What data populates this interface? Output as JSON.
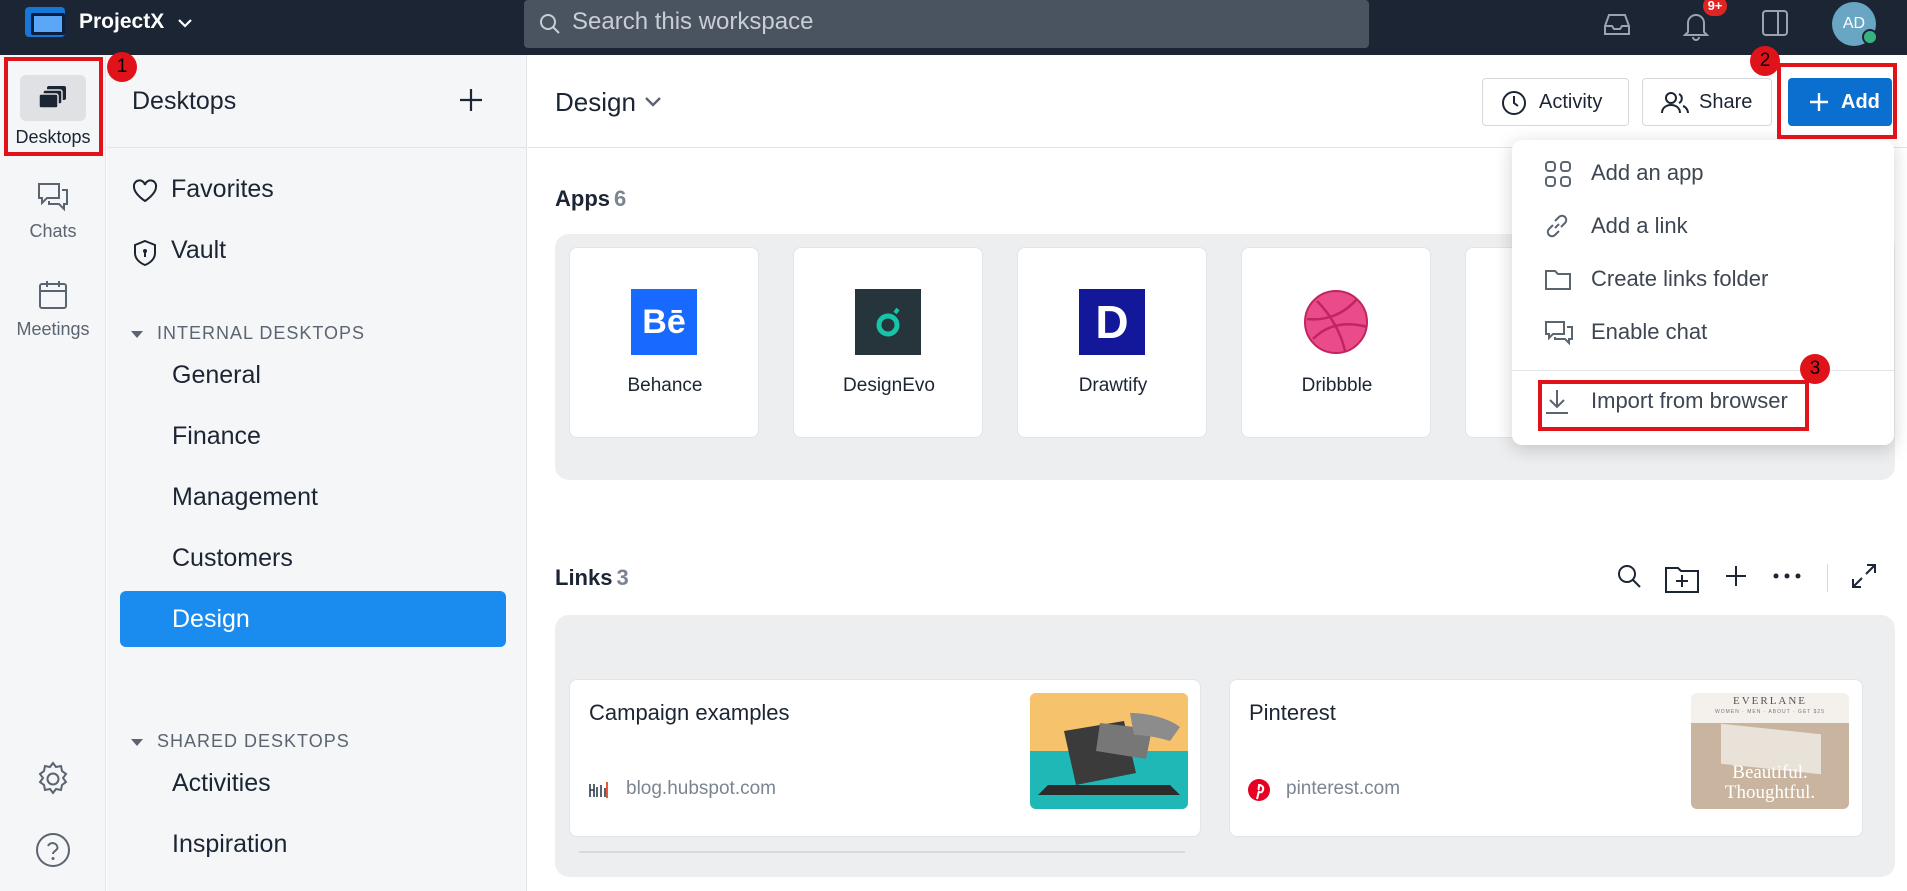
{
  "topbar": {
    "app_name": "ProjectX",
    "search_placeholder": "Search this workspace",
    "notification_badge": "9+",
    "avatar_initials": "AD"
  },
  "rail": {
    "items": [
      {
        "label": "Desktops",
        "icon": "desktops-icon"
      },
      {
        "label": "Chats",
        "icon": "chat-icon"
      },
      {
        "label": "Meetings",
        "icon": "calendar-icon"
      }
    ],
    "bottom_icons": [
      "gear-icon",
      "help-icon"
    ]
  },
  "sidebar": {
    "title": "Desktops",
    "top_items": [
      {
        "label": "Favorites",
        "icon": "heart-icon"
      },
      {
        "label": "Vault",
        "icon": "shield-icon"
      }
    ],
    "internal_section": "INTERNAL DESKTOPS",
    "internal_items": [
      "General",
      "Finance",
      "Management",
      "Customers",
      "Design"
    ],
    "active_item": "Design",
    "shared_section": "SHARED DESKTOPS",
    "shared_items": [
      "Activities",
      "Inspiration"
    ]
  },
  "main": {
    "title": "Design",
    "buttons": {
      "activity": "Activity",
      "share": "Share",
      "add": "Add"
    },
    "apps": {
      "label": "Apps",
      "count": "6",
      "items": [
        {
          "name": "Behance",
          "logo_text": "Bē",
          "color": "#1769ff"
        },
        {
          "name": "DesignEvo",
          "color": "#26343b"
        },
        {
          "name": "Drawtify",
          "logo_text": "D",
          "color": "#13189a"
        },
        {
          "name": "Dribbble",
          "color": "#ea4c89"
        }
      ]
    },
    "links": {
      "label": "Links",
      "count": "3",
      "items": [
        {
          "title": "Campaign examples",
          "domain": "blog.hubspot.com"
        },
        {
          "title": "Pinterest",
          "domain": "pinterest.com",
          "thumb_brand": "EVERLANE",
          "thumb_nav": "WOMEN · MEN · ABOUT · GET $25",
          "thumb_caption_1": "Beautiful.",
          "thumb_caption_2": "Thoughtful."
        }
      ]
    }
  },
  "dropdown": {
    "items": [
      {
        "label": "Add an app",
        "icon": "apps-grid-icon"
      },
      {
        "label": "Add a link",
        "icon": "link-icon"
      },
      {
        "label": "Create links folder",
        "icon": "folder-icon"
      },
      {
        "label": "Enable chat",
        "icon": "chat-icon"
      },
      {
        "label": "Import from browser",
        "icon": "download-icon"
      }
    ]
  },
  "annotations": [
    "1",
    "2",
    "3"
  ],
  "colors": {
    "accent": "#1a8cf0",
    "add_button": "#0b6fd0",
    "highlight": "#e0131b",
    "topbar": "#1b2533"
  }
}
